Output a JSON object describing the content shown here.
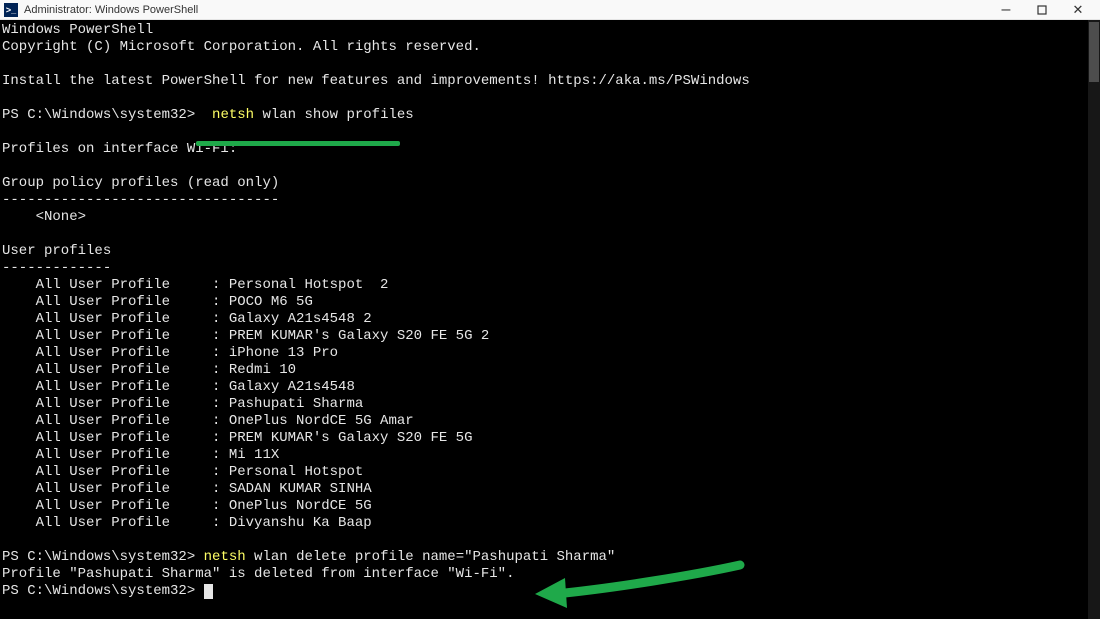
{
  "titlebar": {
    "icon_glyph": ">_",
    "title": "Administrator: Windows PowerShell"
  },
  "terminal": {
    "header1": "Windows PowerShell",
    "header2": "Copyright (C) Microsoft Corporation. All rights reserved.",
    "install_msg": "Install the latest PowerShell for new features and improvements! https://aka.ms/PSWindows",
    "prompt1_path": "PS C:\\Windows\\system32>  ",
    "cmd1_y": "netsh",
    "cmd1_rest": " wlan show profiles",
    "profiles_header": "Profiles on interface Wi-Fi:",
    "gp_header": "Group policy profiles (read only)",
    "gp_dashes": "---------------------------------",
    "gp_none": "    <None>",
    "user_profiles_header": "User profiles",
    "user_profiles_dashes": "-------------",
    "profiles": [
      "    All User Profile     : Personal Hotspot  2",
      "    All User Profile     : POCO M6 5G",
      "    All User Profile     : Galaxy A21s4548 2",
      "    All User Profile     : PREM KUMAR's Galaxy S20 FE 5G 2",
      "    All User Profile     : iPhone 13 Pro",
      "    All User Profile     : Redmi 10",
      "    All User Profile     : Galaxy A21s4548",
      "    All User Profile     : Pashupati Sharma",
      "    All User Profile     : OnePlus NordCE 5G Amar",
      "    All User Profile     : PREM KUMAR's Galaxy S20 FE 5G",
      "    All User Profile     : Mi 11X",
      "    All User Profile     : Personal Hotspot",
      "    All User Profile     : SADAN KUMAR SINHA",
      "    All User Profile     : OnePlus NordCE 5G",
      "    All User Profile     : Divyanshu Ka Baap"
    ],
    "prompt2_path": "PS C:\\Windows\\system32> ",
    "cmd2_y": "netsh",
    "cmd2_rest": " wlan delete profile name=\"Pashupati Sharma\"",
    "delete_result": "Profile \"Pashupati Sharma\" is deleted from interface \"Wi-Fi\".",
    "prompt3_path": "PS C:\\Windows\\system32> "
  }
}
